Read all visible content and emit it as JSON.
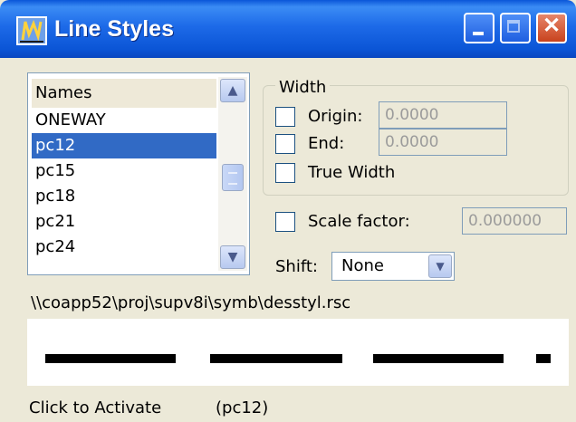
{
  "window": {
    "title": "Line Styles",
    "controls": {
      "minimize": "minimize",
      "maximize": "maximize",
      "close": "close"
    }
  },
  "names_list": {
    "header": "Names",
    "items": [
      "ONEWAY",
      "pc12",
      "pc15",
      "pc18",
      "pc21",
      "pc24"
    ],
    "selected_index": 1,
    "selected_value": "pc12"
  },
  "width_group": {
    "title": "Width",
    "origin": {
      "label": "Origin:",
      "value": "0.0000",
      "checked": false
    },
    "end": {
      "label": "End:",
      "value": "0.0000",
      "checked": false
    },
    "true_width": {
      "label": "True Width",
      "checked": false
    }
  },
  "scale": {
    "label": "Scale factor:",
    "value": "0.000000",
    "checked": false
  },
  "shift": {
    "label": "Shift:",
    "value": "None"
  },
  "resource_path": "\\\\coapp52\\proj\\supv8i\\symb\\desstyl.rsc",
  "status": {
    "message": "Click to Activate",
    "current": "(pc12)"
  },
  "colors": {
    "titlebar": "#0a56d8",
    "selection": "#316ac5",
    "dialog_bg": "#ece9d8"
  }
}
